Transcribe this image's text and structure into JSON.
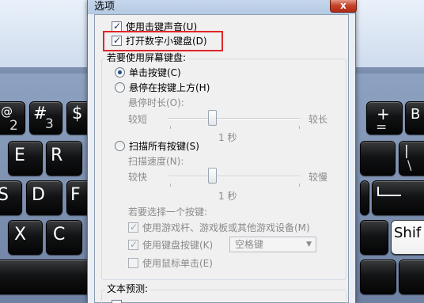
{
  "dialog": {
    "title": "选项",
    "close_label": "x",
    "options": {
      "click_sound": "使用击键声音(U)",
      "numeric_keypad": "打开数字小键盘(D)"
    },
    "usage": {
      "heading": "若要使用屏幕键盘:",
      "click_keys": "单击按键(C)",
      "hover_keys": "悬停在按键上方(H)",
      "hover_duration_label": "悬停时长(O):",
      "short_label": "较短",
      "long_label": "较长",
      "hover_value": "1 秒",
      "scan_keys": "扫描所有按键(S)",
      "scan_speed_label": "扫描速度(N):",
      "fast_label": "较快",
      "slow_label": "较慢",
      "scan_value": "1 秒",
      "select_key_heading": "若要选择一个按键:",
      "use_joystick": "使用游戏杆、游戏板或其他游戏设备(M)",
      "use_keyboard_key": "使用键盘按键(K)",
      "keyboard_key_value": "空格键",
      "use_mouse_click": "使用鼠标单击(E)"
    },
    "text_prediction": {
      "heading": "文本预测:"
    }
  },
  "keyboard": {
    "keys_left": [
      {
        "main": "@",
        "sub": "2"
      },
      {
        "main": "#",
        "sub": "3"
      },
      {
        "main": "$",
        "sub": ""
      },
      {
        "main": "E",
        "sub": ""
      },
      {
        "main": "R",
        "sub": ""
      },
      {
        "main": "S",
        "sub": ""
      },
      {
        "main": "D",
        "sub": ""
      },
      {
        "main": "F",
        "sub": ""
      },
      {
        "main": "X",
        "sub": ""
      },
      {
        "main": "C",
        "sub": ""
      }
    ],
    "keys_right": [
      {
        "main": "+",
        "sub": "="
      },
      {
        "main": "B",
        "sub": ""
      },
      {
        "main": "|",
        "sub": "\\"
      },
      {
        "main": "Shif",
        "sub": ""
      }
    ]
  },
  "colors": {
    "highlight": "#e0262a",
    "close_button": "#c7432a",
    "key_face": "#121314"
  }
}
